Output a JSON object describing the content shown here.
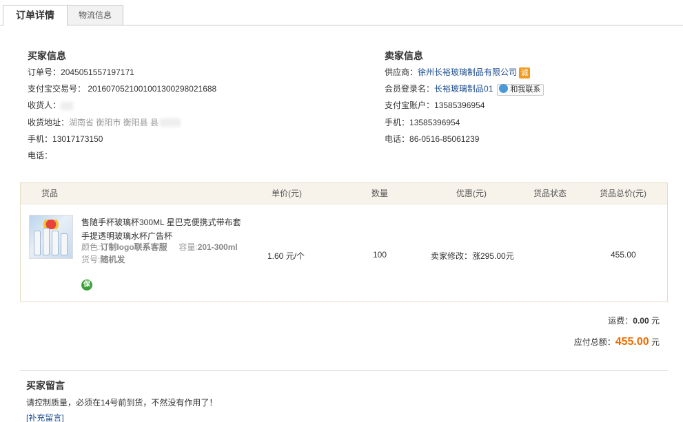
{
  "tabs": [
    {
      "label": "订单详情",
      "active": true
    },
    {
      "label": "物流信息",
      "active": false
    }
  ],
  "buyer": {
    "heading": "买家信息",
    "order_no_label": "订单号：",
    "order_no": "2045051557197171",
    "alipay_txn_label": "支付宝交易号：",
    "alipay_txn": "2016070521001001300298021688",
    "receiver_label": "收货人：",
    "address_label": "收货地址：",
    "address": "湖南省 衡阳市 衡阳县 县",
    "mobile_label": "手机：",
    "mobile": "13017173150",
    "phone_label": "电话："
  },
  "seller": {
    "heading": "卖家信息",
    "supplier_label": "供应商：",
    "supplier": "徐州长裕玻璃制品有限公司",
    "supplier_badge": "诚",
    "member_label": "会员登录名：",
    "member": "长裕玻璃制品01",
    "contact_button": "和我联系",
    "alipay_label": "支付宝账户：",
    "alipay": "13585396954",
    "mobile_label": "手机：",
    "mobile": "13585396954",
    "phone_label": "电话：",
    "phone": "86-0516-85061239"
  },
  "goods_table": {
    "headers": [
      "货品",
      "单价(元)",
      "数量",
      "优惠(元)",
      "货品状态",
      "货品总价(元)"
    ],
    "item": {
      "title": "售随手杯玻璃杯300ML 星巴克便携式带布套手提透明玻璃水杯广告杯",
      "color_label": "颜色:",
      "color_value": "订制logo联系客服",
      "capacity_label": "容量:",
      "capacity_value": "201-300ml",
      "sku_label": "货号:",
      "sku_value": "随机发",
      "bao_badge": "保",
      "unit_price": "1.60 元/个",
      "quantity": "100",
      "discount": "卖家修改：涨295.00元",
      "status": "",
      "total": "455.00"
    }
  },
  "summary": {
    "shipping_label": "运费：",
    "shipping_value": "0.00",
    "shipping_unit": "元",
    "total_label": "应付总额：",
    "total_value": "455.00",
    "total_unit": "元"
  },
  "buyer_note": {
    "heading": "买家留言",
    "text": "请控制质量，必须在14号前到货，不然没有作用了！",
    "add_link": "[补充留言]"
  },
  "colors": {
    "link": "#1f4f8f",
    "accent_total": "#f06b00",
    "table_header_bg": "#f7f3ea"
  }
}
